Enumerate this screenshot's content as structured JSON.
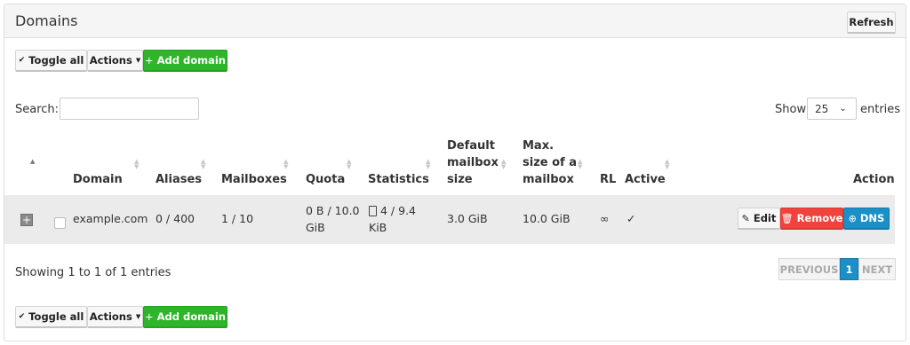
{
  "panel": {
    "title": "Domains",
    "refresh_label": "Refresh"
  },
  "toolbar": {
    "toggle_all": "Toggle all",
    "actions": "Actions",
    "add_domain": "Add domain"
  },
  "search": {
    "label": "Search:",
    "value": ""
  },
  "length": {
    "show_label": "Show",
    "selected": "25",
    "entries_label": "entries"
  },
  "columns": {
    "domain": "Domain",
    "aliases": "Aliases",
    "mailboxes": "Mailboxes",
    "quota": "Quota",
    "statistics": "Statistics",
    "default_mailbox_size": [
      "Default",
      "mailbox",
      "size"
    ],
    "max_size": [
      "Max.",
      "size of a",
      "mailbox"
    ],
    "rl": "RL",
    "active": "Active",
    "action": "Action"
  },
  "rows": [
    {
      "domain": "example.com",
      "aliases": "0 / 400",
      "mailboxes": "1 / 10",
      "quota": [
        "0 B / 10.0",
        "GiB"
      ],
      "statistics": [
        "4 / 9.4",
        "KiB"
      ],
      "default_mailbox_size": "3.0 GiB",
      "max_size": "10.0 GiB",
      "rl": "∞",
      "active": "✓",
      "actions": {
        "edit": "Edit",
        "remove": "Remove",
        "dns": "DNS"
      }
    }
  ],
  "info": "Showing 1 to 1 of 1 entries",
  "pagination": {
    "previous": "PREVIOUS",
    "current": "1",
    "next": "NEXT"
  }
}
